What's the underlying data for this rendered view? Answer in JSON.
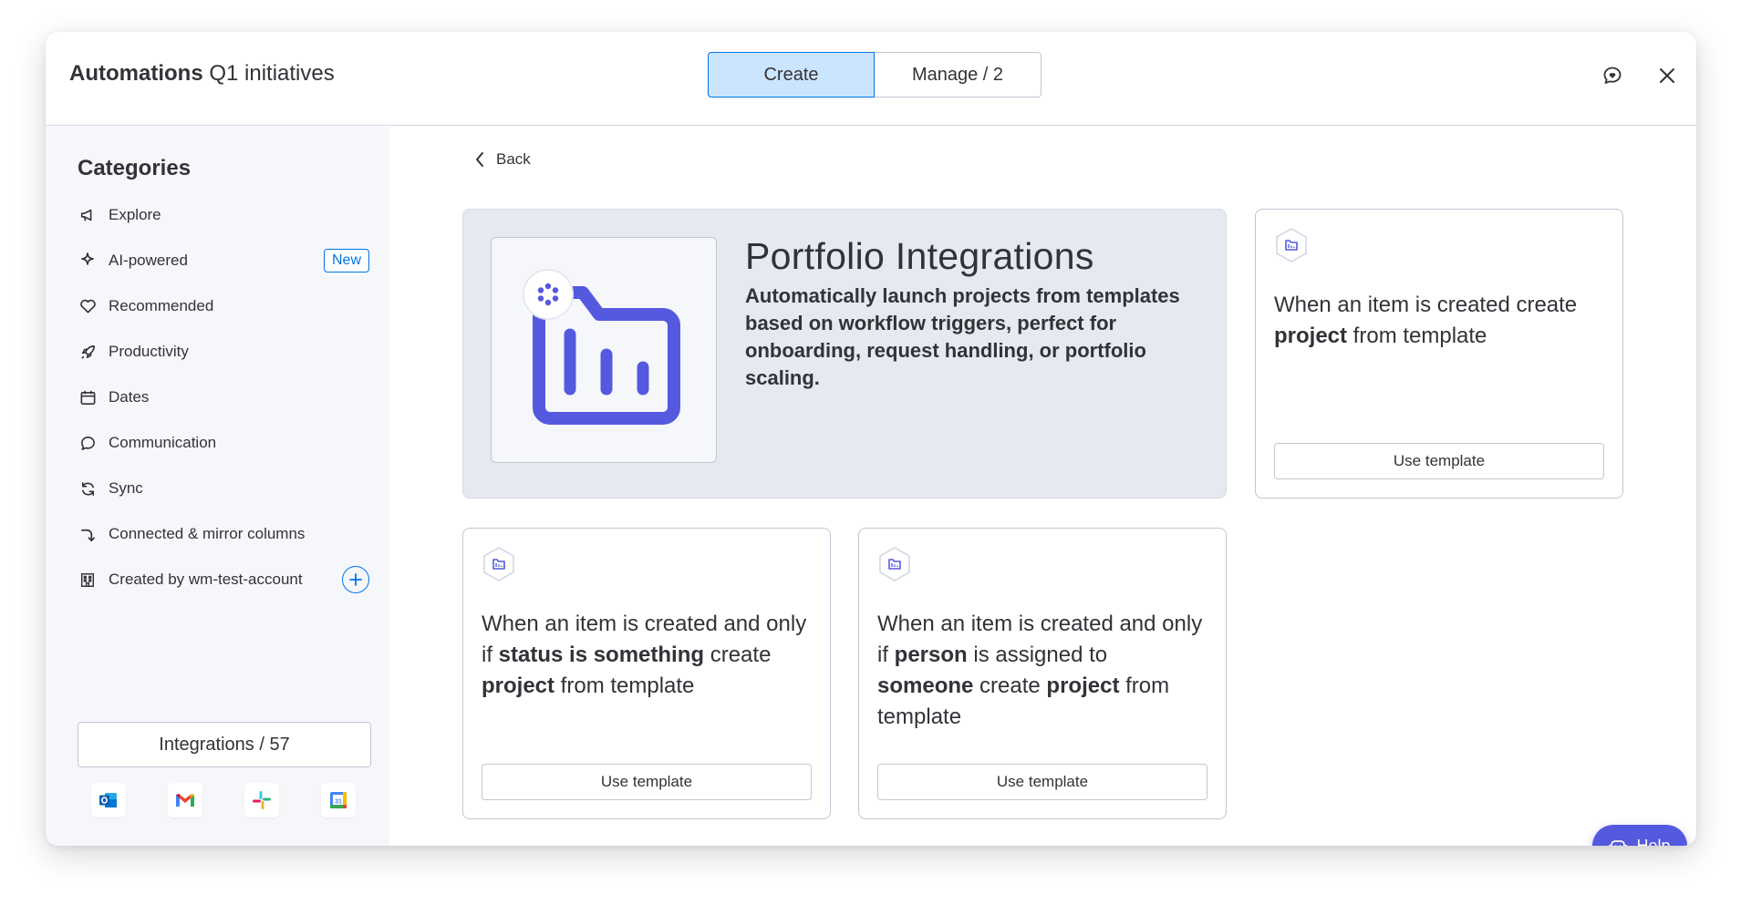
{
  "header": {
    "title_bold": "Automations",
    "title_rest": "Q1 initiatives",
    "tabs": [
      {
        "label": "Create",
        "active": true
      },
      {
        "label": "Manage / 2",
        "active": false
      }
    ],
    "feedback_icon": "chat-heart-icon",
    "close_icon": "close-icon"
  },
  "sidebar": {
    "title": "Categories",
    "items": [
      {
        "label": "Explore",
        "icon": "megaphone-icon"
      },
      {
        "label": "AI-powered",
        "icon": "sparkle-icon",
        "badge": "New"
      },
      {
        "label": "Recommended",
        "icon": "heart-icon"
      },
      {
        "label": "Productivity",
        "icon": "rocket-icon"
      },
      {
        "label": "Dates",
        "icon": "calendar-icon"
      },
      {
        "label": "Communication",
        "icon": "speech-bubble-icon"
      },
      {
        "label": "Sync",
        "icon": "sync-icon"
      },
      {
        "label": "Connected & mirror columns",
        "icon": "connect-icon"
      },
      {
        "label": "Created by wm-test-account",
        "icon": "building-icon"
      }
    ],
    "integrations_label": "Integrations / 57",
    "apps": [
      "outlook-icon",
      "gmail-icon",
      "slack-icon",
      "google-calendar-icon"
    ]
  },
  "main": {
    "back_label": "Back",
    "hero": {
      "title": "Portfolio Integrations",
      "description": "Automatically launch projects from templates based on workflow triggers, perfect for onboarding, request handling, or portfolio scaling."
    },
    "cards": [
      {
        "parts": [
          {
            "t": "When an item is created create ",
            "b": false
          },
          {
            "t": "project",
            "b": true
          },
          {
            "t": " from template",
            "b": false
          }
        ],
        "button": "Use template"
      },
      {
        "parts": [
          {
            "t": "When an item is created and only if ",
            "b": false
          },
          {
            "t": "status is something",
            "b": true
          },
          {
            "t": " create ",
            "b": false
          },
          {
            "t": "project",
            "b": true
          },
          {
            "t": " from template",
            "b": false
          }
        ],
        "button": "Use template"
      },
      {
        "parts": [
          {
            "t": "When an item is created and only if ",
            "b": false
          },
          {
            "t": "person",
            "b": true
          },
          {
            "t": " is assigned to ",
            "b": false
          },
          {
            "t": "someone",
            "b": true
          },
          {
            "t": " create ",
            "b": false
          },
          {
            "t": "project",
            "b": true
          },
          {
            "t": " from template",
            "b": false
          }
        ],
        "button": "Use template"
      }
    ]
  },
  "help": {
    "label": "Help"
  },
  "colors": {
    "primary": "#0073ea",
    "selected_bg": "#cce5ff",
    "portfolio_purple": "#5559df",
    "sidebar_bg": "#f6f7fb"
  }
}
